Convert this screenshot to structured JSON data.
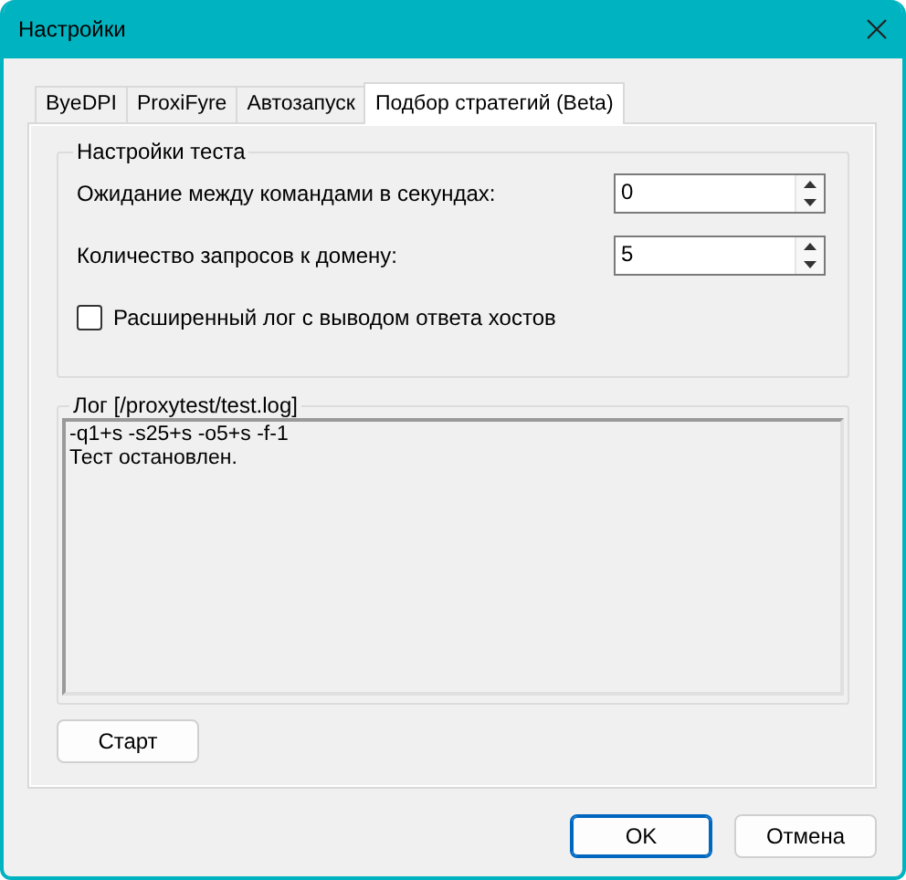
{
  "window": {
    "title": "Настройки"
  },
  "tabs": [
    {
      "label": "ByeDPI",
      "selected": false
    },
    {
      "label": "ProxiFyre",
      "selected": false
    },
    {
      "label": "Автозапуск",
      "selected": false
    },
    {
      "label": "Подбор стратегий (Beta)",
      "selected": true
    }
  ],
  "test_settings": {
    "title": "Настройки теста",
    "fields": [
      {
        "label": "Ожидание между командами в секундах:",
        "value": "0"
      },
      {
        "label": "Количество запросов к домену:",
        "value": "5"
      }
    ],
    "checkbox": {
      "label": "Расширенный лог с выводом ответа хостов",
      "checked": false
    }
  },
  "log": {
    "title": "Лог [/proxytest/test.log]",
    "lines": [
      "-q1+s -s25+s -o5+s -f-1",
      "Тест остановлен."
    ]
  },
  "start_button": "Старт",
  "buttons": [
    {
      "label": "OK",
      "default": true
    },
    {
      "label": "Отмена",
      "default": false
    }
  ]
}
